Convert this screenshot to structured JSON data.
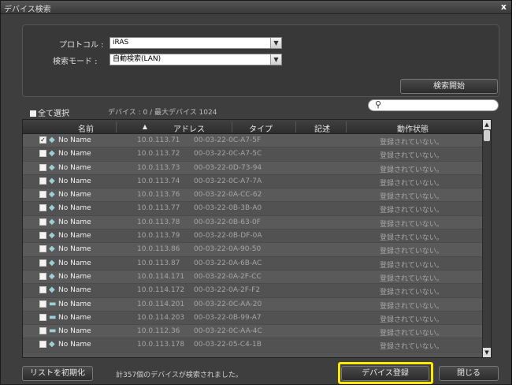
{
  "window": {
    "title": "デバイス検索",
    "close_label": "x"
  },
  "form": {
    "protocol_label": "プロトコル :",
    "protocol_value": "iRAS",
    "search_mode_label": "検索モード :",
    "search_mode_value": "自動検索(LAN)"
  },
  "buttons": {
    "start_search": "検索開始",
    "reset_list": "リストを初期化",
    "register_device": "デバイス登録",
    "close": "閉じる"
  },
  "select_all_label": "全て選択",
  "device_count": "デバイス : 0 / 最大デバイス 1024",
  "search": {
    "placeholder": "",
    "icon": "search-icon"
  },
  "table": {
    "columns": {
      "name": "名前",
      "sort_indicator": "▲",
      "address": "アドレス",
      "type": "タイプ",
      "description": "記述",
      "status": "動作状態"
    },
    "rows": [
      {
        "checked": true,
        "icon": "camera",
        "name": "No Name",
        "ip": "10.0.113.71",
        "mac": "00-03-22-0C-A7-5F",
        "status": "登録されていない。"
      },
      {
        "checked": false,
        "icon": "camera",
        "name": "No Name",
        "ip": "10.0.113.72",
        "mac": "00-03-22-0C-A7-5C",
        "status": "登録されていない。"
      },
      {
        "checked": false,
        "icon": "camera",
        "name": "No Name",
        "ip": "10.0.113.73",
        "mac": "00-03-22-0D-73-94",
        "status": "登録されていない。"
      },
      {
        "checked": false,
        "icon": "camera",
        "name": "No Name",
        "ip": "10.0.113.74",
        "mac": "00-03-22-0C-A7-7A",
        "status": "登録されていない。"
      },
      {
        "checked": false,
        "icon": "camera",
        "name": "No Name",
        "ip": "10.0.113.76",
        "mac": "00-03-22-0A-CC-62",
        "status": "登録されていない。"
      },
      {
        "checked": false,
        "icon": "camera",
        "name": "No Name",
        "ip": "10.0.113.77",
        "mac": "00-03-22-0B-3B-A0",
        "status": "登録されていない。"
      },
      {
        "checked": false,
        "icon": "camera",
        "name": "No Name",
        "ip": "10.0.113.78",
        "mac": "00-03-22-0B-63-0F",
        "status": "登録されていない。"
      },
      {
        "checked": false,
        "icon": "camera",
        "name": "No Name",
        "ip": "10.0.113.79",
        "mac": "00-03-22-0B-DF-0A",
        "status": "登録されていない。"
      },
      {
        "checked": false,
        "icon": "camera",
        "name": "No Name",
        "ip": "10.0.113.86",
        "mac": "00-03-22-0A-90-50",
        "status": "登録されていない。"
      },
      {
        "checked": false,
        "icon": "camera",
        "name": "No Name",
        "ip": "10.0.113.87",
        "mac": "00-03-22-0A-6B-AC",
        "status": "登録されていない。"
      },
      {
        "checked": false,
        "icon": "camera",
        "name": "No Name",
        "ip": "10.0.114.171",
        "mac": "00-03-22-0A-2F-CC",
        "status": "登録されていない。"
      },
      {
        "checked": false,
        "icon": "camera",
        "name": "No Name",
        "ip": "10.0.114.172",
        "mac": "00-03-22-0A-2F-F2",
        "status": "登録されていない。"
      },
      {
        "checked": false,
        "icon": "dvr",
        "name": "No Name",
        "ip": "10.0.114.201",
        "mac": "00-03-22-0C-AA-20",
        "status": "登録されていない。"
      },
      {
        "checked": false,
        "icon": "dvr",
        "name": "No Name",
        "ip": "10.0.114.203",
        "mac": "00-03-22-0B-99-A7",
        "status": "登録されていない。"
      },
      {
        "checked": false,
        "icon": "dvr",
        "name": "No Name",
        "ip": "10.0.112.36",
        "mac": "00-03-22-0C-AA-4C",
        "status": "登録されていない。"
      },
      {
        "checked": false,
        "icon": "camera",
        "name": "No Name",
        "ip": "10.0.113.178",
        "mac": "00-03-22-05-C4-1B",
        "status": "登録されていない。"
      }
    ]
  },
  "status_message": "計357個のデバイスが検索されました。",
  "colors": {
    "highlight": "#ffe800",
    "background": "#3e3e3e"
  }
}
